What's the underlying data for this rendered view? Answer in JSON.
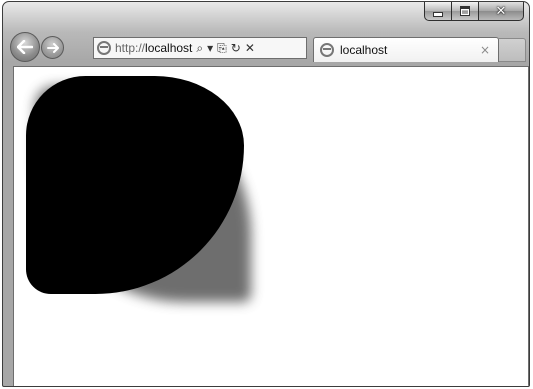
{
  "window": {
    "controls": {
      "minimize": "minimize",
      "maximize": "maximize",
      "close": "✕"
    }
  },
  "navigation": {
    "back_icon": "back-arrow-icon",
    "forward_icon": "forward-arrow-icon"
  },
  "address_bar": {
    "protocol": "http://",
    "host": "localhost",
    "tools": {
      "search_glyph": "⌕",
      "dropdown_glyph": "▾",
      "compat_glyph": "⎘",
      "refresh_glyph": "↻",
      "stop_glyph": "✕"
    }
  },
  "tabs": [
    {
      "label": "localhost",
      "close_glyph": "×"
    }
  ],
  "content": {
    "shape_color": "#000000"
  }
}
